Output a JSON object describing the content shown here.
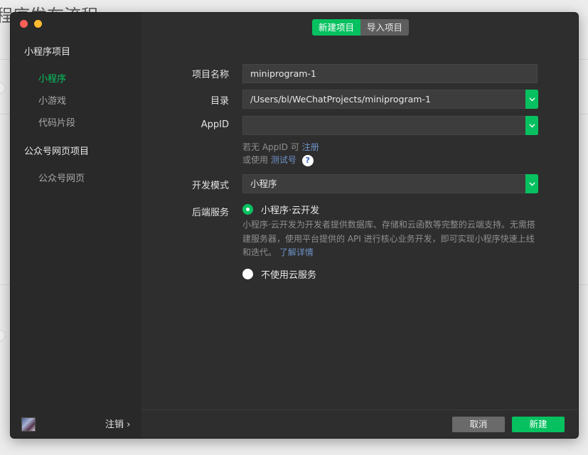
{
  "background": {
    "partial_title": "程序发布流程"
  },
  "sidebar": {
    "section1_title": "小程序项目",
    "items": [
      {
        "label": "小程序",
        "active": true
      },
      {
        "label": "小游戏",
        "active": false
      },
      {
        "label": "代码片段",
        "active": false
      }
    ],
    "section2_title": "公众号网页项目",
    "items2": [
      {
        "label": "公众号网页",
        "active": false
      }
    ],
    "logout_label": "注销 ›"
  },
  "tabs": {
    "new_project": "新建项目",
    "import_project": "导入项目"
  },
  "form": {
    "name_label": "项目名称",
    "name_value": "miniprogram-1",
    "dir_label": "目录",
    "dir_value": "/Users/bl/WeChatProjects/miniprogram-1",
    "appid_label": "AppID",
    "appid_value": "",
    "appid_hint_prefix": "若无 AppID 可",
    "appid_hint_link": "注册",
    "appid_hint2_prefix": "或使用",
    "appid_hint2_link": "测试号",
    "help_glyph": "?",
    "mode_label": "开发模式",
    "mode_value": "小程序",
    "backend_label": "后端服务",
    "option_cloud": "小程序·云开发",
    "cloud_desc": "小程序·云开发为开发者提供数据库、存储和云函数等完整的云端支持。无需搭建服务器，使用平台提供的 API 进行核心业务开发，即可实现小程序快速上线和迭代。",
    "cloud_desc_link": "了解详情",
    "option_none": "不使用云服务"
  },
  "footer": {
    "cancel_label": "取消",
    "create_label": "新建"
  },
  "colors": {
    "accent": "#07c160",
    "link": "#6e93c9"
  }
}
